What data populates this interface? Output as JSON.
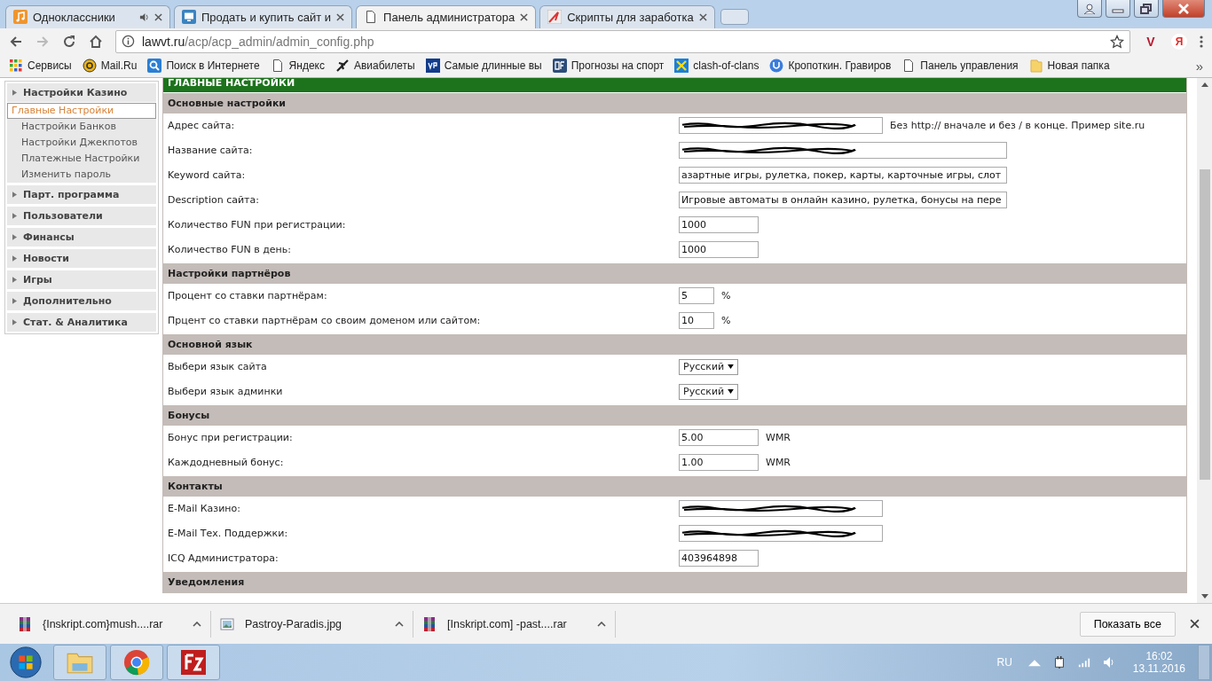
{
  "tabs": [
    {
      "title": "Одноклассники",
      "audio": true,
      "selected": false
    },
    {
      "title": "Продать и купить сайт и",
      "audio": false,
      "selected": false
    },
    {
      "title": "Панель администратора",
      "audio": false,
      "selected": true
    },
    {
      "title": "Скрипты для заработка",
      "audio": false,
      "selected": false
    }
  ],
  "address": {
    "host": "lawvt.ru",
    "path": "/acp/acp_admin/admin_config.php"
  },
  "extensions": [
    "V",
    "Я"
  ],
  "bookmarks": [
    {
      "label": "Сервисы"
    },
    {
      "label": "Mail.Ru"
    },
    {
      "label": "Поиск в Интернете"
    },
    {
      "label": "Яндекс"
    },
    {
      "label": "Авиабилеты"
    },
    {
      "label": "Самые длинные вы"
    },
    {
      "label": "Прогнозы на спорт"
    },
    {
      "label": "clash-of-clans"
    },
    {
      "label": "Кропоткин. Гравиров"
    },
    {
      "label": "Панель управления"
    },
    {
      "label": "Новая папка"
    }
  ],
  "bookmarks_more": "»",
  "sidebar": [
    {
      "label": "Настройки Казино",
      "children": [
        {
          "label": "Главные Настройки",
          "selected": true
        },
        {
          "label": "Настройки Банков",
          "selected": false
        },
        {
          "label": "Настройки Джекпотов",
          "selected": false
        },
        {
          "label": "Платежные Настройки",
          "selected": false
        },
        {
          "label": "Изменить пароль",
          "selected": false
        }
      ]
    },
    {
      "label": "Парт. программа"
    },
    {
      "label": "Пользователи"
    },
    {
      "label": "Финансы"
    },
    {
      "label": "Новости"
    },
    {
      "label": "Игры"
    },
    {
      "label": "Дополнительно"
    },
    {
      "label": "Стат. & Аналитика"
    }
  ],
  "main": {
    "header": "ГЛАВНЫЕ НАСТРОЙКИ",
    "sections": [
      {
        "title": "Основные настройки",
        "rows": [
          {
            "label": "Адрес сайта:",
            "kind": "medium",
            "redacted": true,
            "note": "Без http:// вначале и без / в конце. Пример site.ru"
          },
          {
            "label": "Название сайта:",
            "kind": "wide",
            "redacted": true
          },
          {
            "label": "Keyword сайта:",
            "kind": "wide",
            "value": "азартные игры, рулетка, покер, карты, карточные игры, слот"
          },
          {
            "label": "Description сайта:",
            "kind": "wide",
            "value": "Игровые автоматы в онлайн казино, рулетка, бонусы на пере"
          },
          {
            "label": "Количество FUN при регистрации:",
            "kind": "short",
            "value": "1000"
          },
          {
            "label": "Количество FUN в день:",
            "kind": "short",
            "value": "1000"
          }
        ]
      },
      {
        "title": "Настройки партнёров",
        "rows": [
          {
            "label": "Процент со ставки партнёрам:",
            "kind": "tiny",
            "value": "5",
            "note": "%"
          },
          {
            "label": "Прцент со ставки партнёрам со своим доменом или сайтом:",
            "kind": "tiny",
            "value": "10",
            "note": "%"
          }
        ]
      },
      {
        "title": "Основной язык",
        "rows": [
          {
            "label": "Выбери язык сайта",
            "kind": "select",
            "value": "Русский"
          },
          {
            "label": "Выбери язык админки",
            "kind": "select",
            "value": "Русский"
          }
        ]
      },
      {
        "title": "Бонусы",
        "rows": [
          {
            "label": "Бонус при регистрации:",
            "kind": "short",
            "value": "5.00",
            "note": "WMR"
          },
          {
            "label": "Каждодневный бонус:",
            "kind": "short",
            "value": "1.00",
            "note": "WMR"
          }
        ]
      },
      {
        "title": "Контакты",
        "rows": [
          {
            "label": "E-Mail Казино:",
            "kind": "medium",
            "redacted": true
          },
          {
            "label": "E-Mail Тех. Поддержки:",
            "kind": "medium",
            "redacted": true
          },
          {
            "label": "ICQ Администратора:",
            "kind": "short",
            "value": "403964898"
          }
        ]
      },
      {
        "title": "Уведомления"
      }
    ]
  },
  "downloads": [
    {
      "name": "{Inskript.com}mush....rar",
      "kind": "archive"
    },
    {
      "name": "Pastroy-Paradis.jpg",
      "kind": "image"
    },
    {
      "name": "[Inskript.com] -past....rar",
      "kind": "archive"
    }
  ],
  "show_all": "Показать все",
  "taskbar": {
    "language": "RU",
    "time": "16:02",
    "date": "13.11.2016"
  }
}
